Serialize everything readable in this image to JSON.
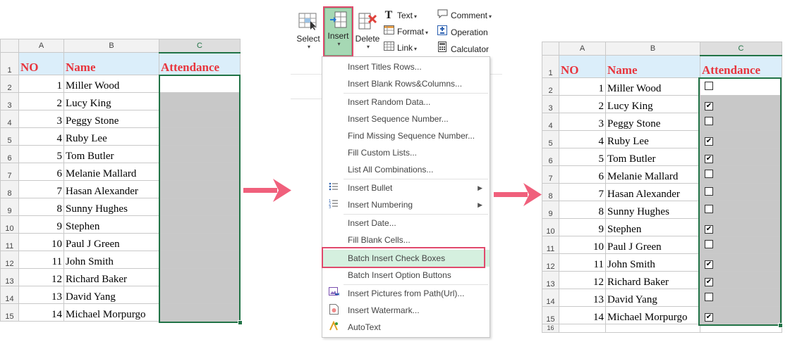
{
  "columns": [
    "A",
    "B",
    "C"
  ],
  "header": {
    "no": "NO",
    "name": "Name",
    "attendance": "Attendance"
  },
  "rows": [
    {
      "r": "2",
      "no": "1",
      "name": "Miller Wood",
      "checked": false
    },
    {
      "r": "3",
      "no": "2",
      "name": "Lucy King",
      "checked": true
    },
    {
      "r": "4",
      "no": "3",
      "name": "Peggy Stone",
      "checked": false
    },
    {
      "r": "5",
      "no": "4",
      "name": "Ruby Lee",
      "checked": true
    },
    {
      "r": "6",
      "no": "5",
      "name": "Tom Butler",
      "checked": true
    },
    {
      "r": "7",
      "no": "6",
      "name": "Melanie Mallard",
      "checked": false
    },
    {
      "r": "8",
      "no": "7",
      "name": "Hasan Alexander",
      "checked": false
    },
    {
      "r": "9",
      "no": "8",
      "name": "Sunny Hughes",
      "checked": false
    },
    {
      "r": "10",
      "no": "9",
      "name": "Stephen",
      "checked": true
    },
    {
      "r": "11",
      "no": "10",
      "name": "Paul J Green",
      "checked": false
    },
    {
      "r": "12",
      "no": "11",
      "name": "John Smith",
      "checked": true
    },
    {
      "r": "13",
      "no": "12",
      "name": "Richard Baker",
      "checked": true
    },
    {
      "r": "14",
      "no": "13",
      "name": "David Yang",
      "checked": false
    },
    {
      "r": "15",
      "no": "14",
      "name": "Michael Morpurgo",
      "checked": true
    }
  ],
  "extra_row_label": "16",
  "ribbon": {
    "select": "Select",
    "insert": "Insert",
    "delete": "Delete",
    "text": "Text",
    "format": "Format",
    "link": "Link",
    "comment": "Comment",
    "operation": "Operation",
    "calculator": "Calculator"
  },
  "menu": {
    "items": [
      "Insert Titles Rows...",
      "Insert Blank Rows&Columns...",
      "Insert Random Data...",
      "Insert Sequence Number...",
      "Find Missing Sequence Number...",
      "Fill Custom Lists...",
      "List All Combinations...",
      "Insert Bullet",
      "Insert Numbering",
      "Insert Date...",
      "Fill Blank Cells...",
      "Batch Insert Check Boxes",
      "Batch Insert Option Buttons",
      "Insert Pictures from Path(Url)...",
      "Insert Watermark...",
      "AutoText"
    ],
    "highlighted": "Batch Insert Check Boxes"
  },
  "colors": {
    "header_text": "#e8353d",
    "header_fill": "#dbeefa",
    "selection": "#217346",
    "highlight_border": "#e04a6c",
    "arrow": "#f0607c"
  }
}
